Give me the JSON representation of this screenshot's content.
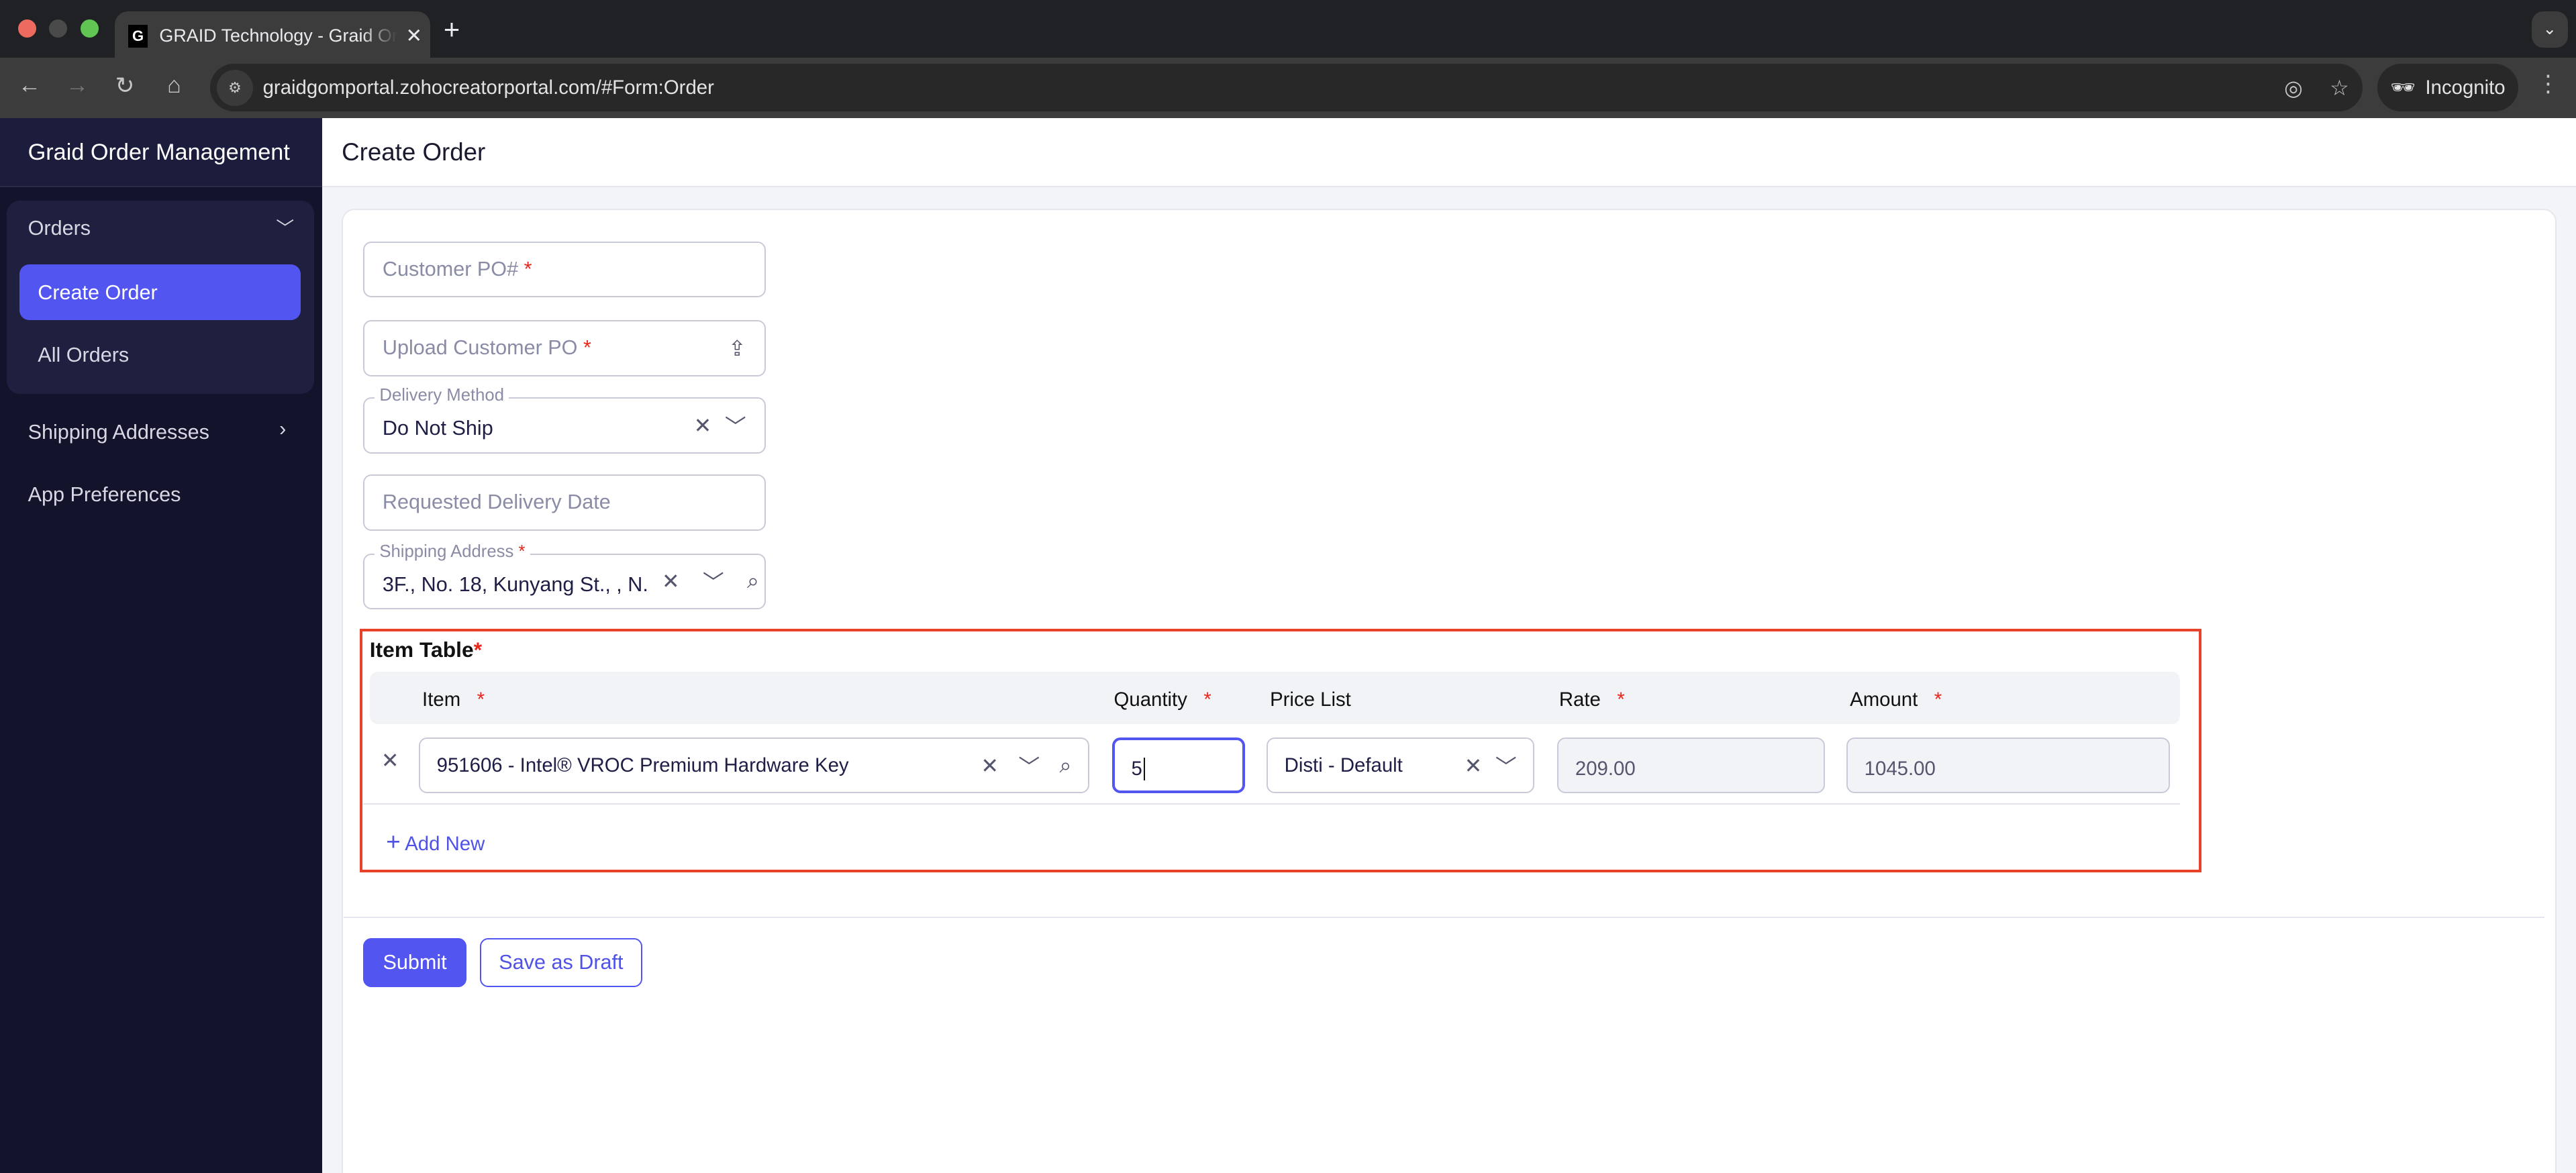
{
  "browser": {
    "tab_title": "GRAID Technology -  Graid Order Management",
    "favicon": "G",
    "url": "graidgomportal.zohocreatorportal.com/#Form:Order",
    "incognito_label": "Incognito",
    "traffic_colors": [
      "#ed6a5e",
      "#4a4a4a",
      "#61c554"
    ]
  },
  "sidebar": {
    "app_title": "Graid Order Management",
    "orders_label": "Orders",
    "items": [
      {
        "label": "Create Order",
        "active": true
      },
      {
        "label": "All Orders"
      }
    ],
    "shipping_label": "Shipping Addresses",
    "prefs_label": "App Preferences"
  },
  "page": {
    "title": "Create Order"
  },
  "form": {
    "customer_po_placeholder": "Customer PO#",
    "upload_po_placeholder": "Upload Customer PO",
    "delivery_method_label": "Delivery Method",
    "delivery_method_value": "Do Not Ship",
    "requested_date_placeholder": "Requested Delivery Date",
    "shipping_address_label": "Shipping Address",
    "shipping_address_value": "3F., No. 18, Kunyang St., , N...",
    "required_mark": "*"
  },
  "item_table": {
    "title": "Item Table",
    "columns": [
      "Item",
      "Quantity",
      "Price List",
      "Rate",
      "Amount"
    ],
    "rows": [
      {
        "item": "951606 - Intel® VROC Premium Hardware Key",
        "quantity": "5",
        "price_list": "Disti - Default",
        "rate": "209.00",
        "amount": "1045.00"
      }
    ],
    "add_new_label": "Add New"
  },
  "actions": {
    "submit_label": "Submit",
    "draft_label": "Save as Draft"
  },
  "colors": {
    "accent": "#5355f0",
    "sidebar_bg": "#13132b",
    "highlight_box": "#e8422a",
    "required": "#e8261a"
  }
}
